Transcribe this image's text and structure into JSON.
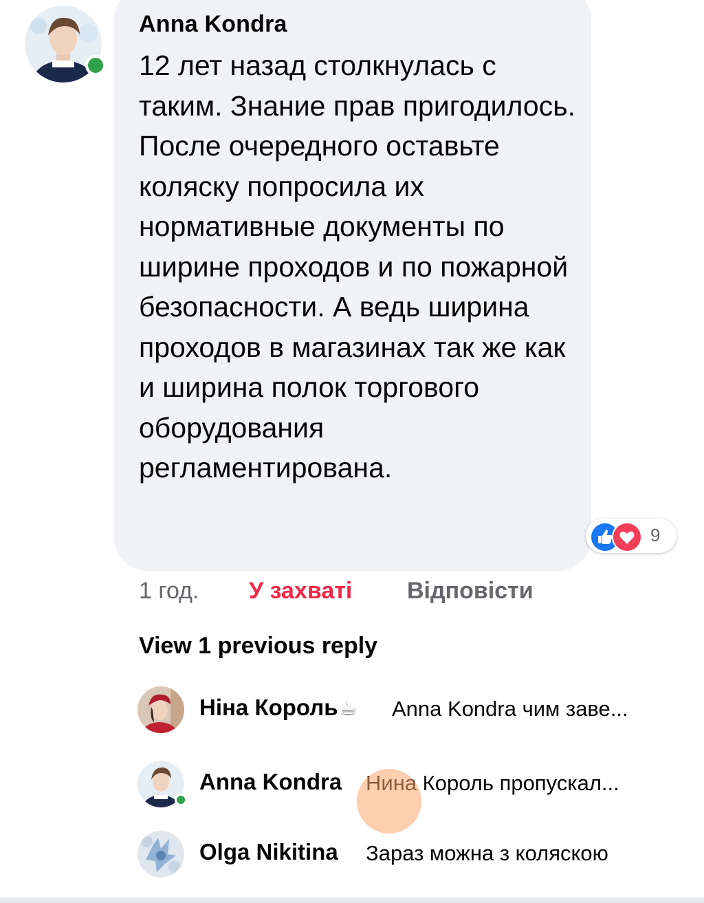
{
  "comment": {
    "author": "Anna Kondra",
    "text": "12 лет назад столкнулась с таким. Знание прав пригодилось. После очередного оставьте коляску попросила их нормативные документы по ширине проходов и по пожарной безопасности. А ведь ширина проходов в магазинах так же как и ширина полок торгового оборудования регламентирована.",
    "reactions": {
      "types": [
        "like-icon",
        "love-icon"
      ],
      "count": "9"
    },
    "time": "1 год.",
    "react_label": "У захваті",
    "reply_label": "Відповісти"
  },
  "view_previous": "View 1 previous reply",
  "replies": [
    {
      "name": "Ніна Король",
      "name_emoji": "☕",
      "snippet": "Anna Kondra чим заве..."
    },
    {
      "name": "Anna Kondra",
      "snippet": "Нина Король пропускал..."
    },
    {
      "name": "Olga Nikitina",
      "snippet": "Зараз можна з коляскою"
    }
  ],
  "colors": {
    "bubble": "#f0f2f5",
    "online": "#31a24c",
    "like": "#1877f2",
    "love": "#f33e58",
    "react_active": "#f02849",
    "meta": "#65676b"
  }
}
